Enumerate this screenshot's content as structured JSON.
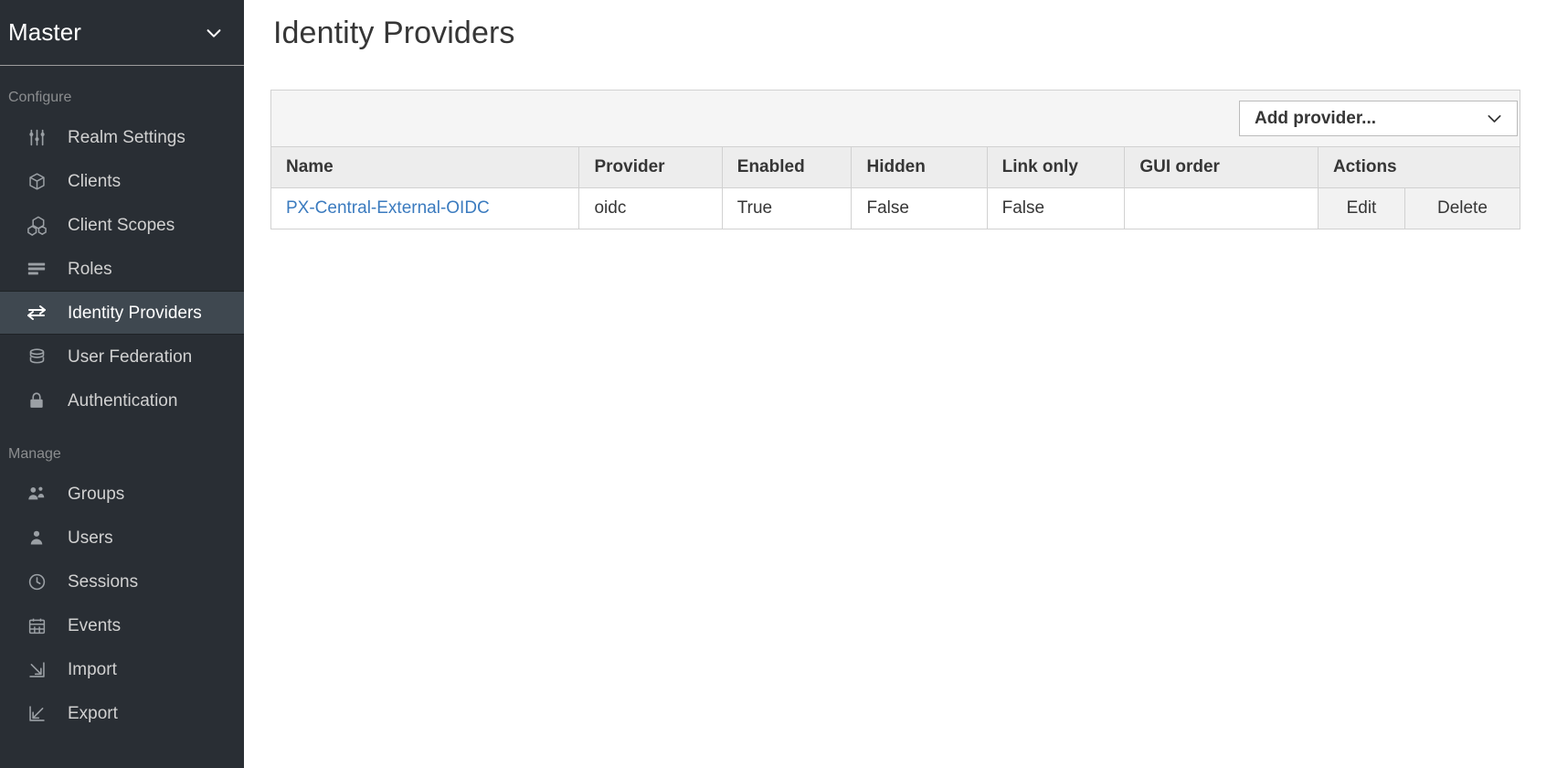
{
  "sidebar": {
    "realm": {
      "name": "Master",
      "chevron_icon": "chevron-down-icon"
    },
    "sections": [
      {
        "title": "Configure",
        "items": [
          {
            "label": "Realm Settings",
            "icon": "sliders-icon",
            "active": false
          },
          {
            "label": "Clients",
            "icon": "cube-icon",
            "active": false
          },
          {
            "label": "Client Scopes",
            "icon": "cubes-icon",
            "active": false
          },
          {
            "label": "Roles",
            "icon": "list-rows-icon",
            "active": false
          },
          {
            "label": "Identity Providers",
            "icon": "exchange-arrows-icon",
            "active": true
          },
          {
            "label": "User Federation",
            "icon": "database-icon",
            "active": false
          },
          {
            "label": "Authentication",
            "icon": "lock-icon",
            "active": false
          }
        ]
      },
      {
        "title": "Manage",
        "items": [
          {
            "label": "Groups",
            "icon": "users-group-icon",
            "active": false
          },
          {
            "label": "Users",
            "icon": "user-icon",
            "active": false
          },
          {
            "label": "Sessions",
            "icon": "clock-icon",
            "active": false
          },
          {
            "label": "Events",
            "icon": "calendar-icon",
            "active": false
          },
          {
            "label": "Import",
            "icon": "import-arrow-icon",
            "active": false
          },
          {
            "label": "Export",
            "icon": "export-arrow-icon",
            "active": false
          }
        ]
      }
    ]
  },
  "main": {
    "page_title": "Identity Providers",
    "toolbar": {
      "add_provider_label": "Add provider...",
      "add_provider_chevron": "chevron-down-icon"
    },
    "table": {
      "columns": [
        "Name",
        "Provider",
        "Enabled",
        "Hidden",
        "Link only",
        "GUI order",
        "Actions"
      ],
      "rows": [
        {
          "name": "PX-Central-External-OIDC",
          "provider": "oidc",
          "enabled": "True",
          "hidden": "False",
          "link_only": "False",
          "gui_order": "",
          "actions": {
            "edit": "Edit",
            "delete": "Delete"
          }
        }
      ]
    }
  },
  "colors": {
    "sidebar_bg": "#292e34",
    "sidebar_active_bg": "#3f4850",
    "link_blue": "#3b7bbf",
    "toolbar_bg": "#f5f5f5",
    "table_header_bg": "#ededed",
    "border": "#d1d1d1"
  }
}
